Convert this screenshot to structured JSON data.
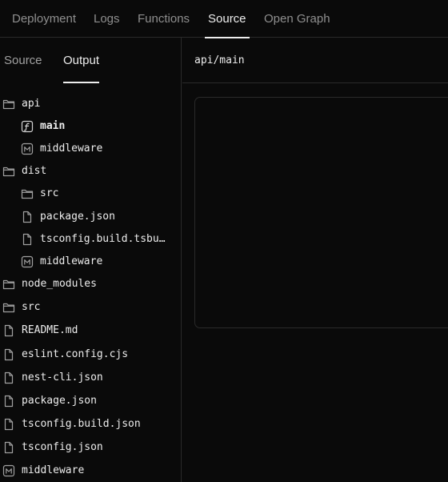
{
  "top_tabs": [
    {
      "label": "Deployment",
      "active": false
    },
    {
      "label": "Logs",
      "active": false
    },
    {
      "label": "Functions",
      "active": false
    },
    {
      "label": "Source",
      "active": true
    },
    {
      "label": "Open Graph",
      "active": false
    }
  ],
  "sidebar_tabs": [
    {
      "label": "Source",
      "active": false
    },
    {
      "label": "Output",
      "active": true
    }
  ],
  "tree": [
    {
      "name": "api",
      "icon": "folder-icon",
      "level": 0
    },
    {
      "name": "main",
      "icon": "function-file-icon",
      "level": 1,
      "selected": true
    },
    {
      "name": "middleware",
      "icon": "middleware-icon",
      "level": 1
    },
    {
      "name": "dist",
      "icon": "folder-icon",
      "level": 0
    },
    {
      "name": "src",
      "icon": "folder-icon",
      "level": 1
    },
    {
      "name": "package.json",
      "icon": "file-icon",
      "level": 1
    },
    {
      "name": "tsconfig.build.tsbu…",
      "icon": "file-icon",
      "level": 1
    },
    {
      "name": "middleware",
      "icon": "middleware-icon",
      "level": 1
    },
    {
      "name": "node_modules",
      "icon": "folder-icon",
      "level": 0
    },
    {
      "name": "src",
      "icon": "folder-icon",
      "level": 0
    },
    {
      "name": "README.md",
      "icon": "file-icon",
      "level": 0
    },
    {
      "name": "eslint.config.cjs",
      "icon": "file-icon",
      "level": 0
    },
    {
      "name": "nest-cli.json",
      "icon": "file-icon",
      "level": 0
    },
    {
      "name": "package.json",
      "icon": "file-icon",
      "level": 0
    },
    {
      "name": "tsconfig.build.json",
      "icon": "file-icon",
      "level": 0
    },
    {
      "name": "tsconfig.json",
      "icon": "file-icon",
      "level": 0
    },
    {
      "name": "middleware",
      "icon": "middleware-icon",
      "level": 0
    }
  ],
  "main": {
    "path": "api/main"
  },
  "colors": {
    "background": "#0a0a0a",
    "border": "#2a2a2a",
    "text": "#ededed",
    "muted": "#8f8f8f"
  }
}
